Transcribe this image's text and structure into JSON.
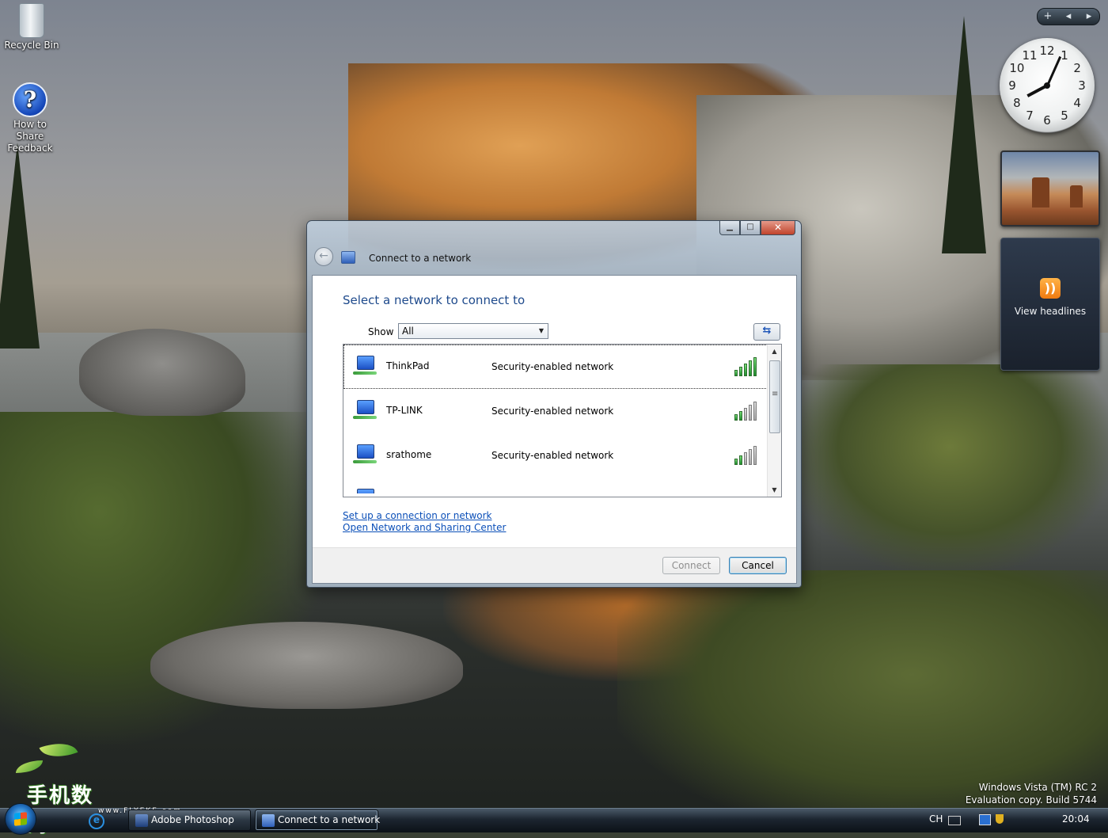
{
  "desktop": {
    "icons": [
      {
        "label": "Recycle Bin"
      },
      {
        "label_line1": "How to Share",
        "label_line2": "Feedback"
      }
    ],
    "watermark_line1": "Windows Vista (TM) RC 2",
    "watermark_line2": "Evaluation copy. Build 5744",
    "logo_text": "手机数码",
    "logo_url": "www.FLYEKE.com"
  },
  "sidebar": {
    "controls": [
      "+",
      "◂",
      "▸"
    ],
    "clock": {
      "hour": 8,
      "minute": 4,
      "numerals": [
        "12",
        "1",
        "2",
        "3",
        "4",
        "5",
        "6",
        "7",
        "8",
        "9",
        "10",
        "11"
      ]
    },
    "feed_label": "View headlines",
    "feed_icon": "rss-icon"
  },
  "dialog": {
    "title": "Connect to a network",
    "heading": "Select a network to connect to",
    "show_label": "Show",
    "show_value": "All",
    "networks": [
      {
        "name": "ThinkPad",
        "security": "Security-enabled network",
        "signal_bars": 5,
        "selected": true
      },
      {
        "name": "TP-LINK",
        "security": "Security-enabled network",
        "signal_bars": 2,
        "selected": false
      },
      {
        "name": "srathome",
        "security": "Security-enabled network",
        "signal_bars": 2,
        "selected": false
      }
    ],
    "links": [
      "Set up a connection or network",
      "Open Network and Sharing Center"
    ],
    "connect_label": "Connect",
    "cancel_label": "Cancel",
    "controls": {
      "minimize": "▁",
      "maximize": "□",
      "close": "✕"
    }
  },
  "taskbar": {
    "tasks": [
      {
        "label": "Adobe Photoshop",
        "active": false
      },
      {
        "label": "Connect to a network",
        "active": true
      }
    ],
    "tray": {
      "language": "CH",
      "time": "20:04"
    }
  },
  "colors": {
    "link": "#0b4fb8",
    "heading": "#1e4a8c",
    "signal_on": "#1f8f2f"
  }
}
